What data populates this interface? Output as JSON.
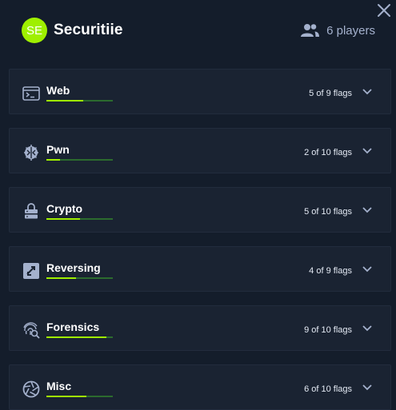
{
  "team": {
    "initials": "SE",
    "name": "Securitiie",
    "players_label": "6 players",
    "avatar_color": "#9fef00"
  },
  "colors": {
    "accent": "#9fef00",
    "background": "#141d2b",
    "card": "#1a2332",
    "muted": "#a4b1cd"
  },
  "categories": [
    {
      "name": "Web",
      "icon": "terminal-window-icon",
      "flags_label": "5 of 9 flags",
      "progress": 0.56
    },
    {
      "name": "Pwn",
      "icon": "brain-chip-icon",
      "flags_label": "2 of 10 flags",
      "progress": 0.2
    },
    {
      "name": "Crypto",
      "icon": "lock-server-icon",
      "flags_label": "5 of 10 flags",
      "progress": 0.5
    },
    {
      "name": "Reversing",
      "icon": "reverse-arrows-icon",
      "flags_label": "4 of 9 flags",
      "progress": 0.44
    },
    {
      "name": "Forensics",
      "icon": "fingerprint-search-icon",
      "flags_label": "9 of 10 flags",
      "progress": 0.9
    },
    {
      "name": "Misc",
      "icon": "aperture-icon",
      "flags_label": "6 of 10 flags",
      "progress": 0.6
    }
  ]
}
